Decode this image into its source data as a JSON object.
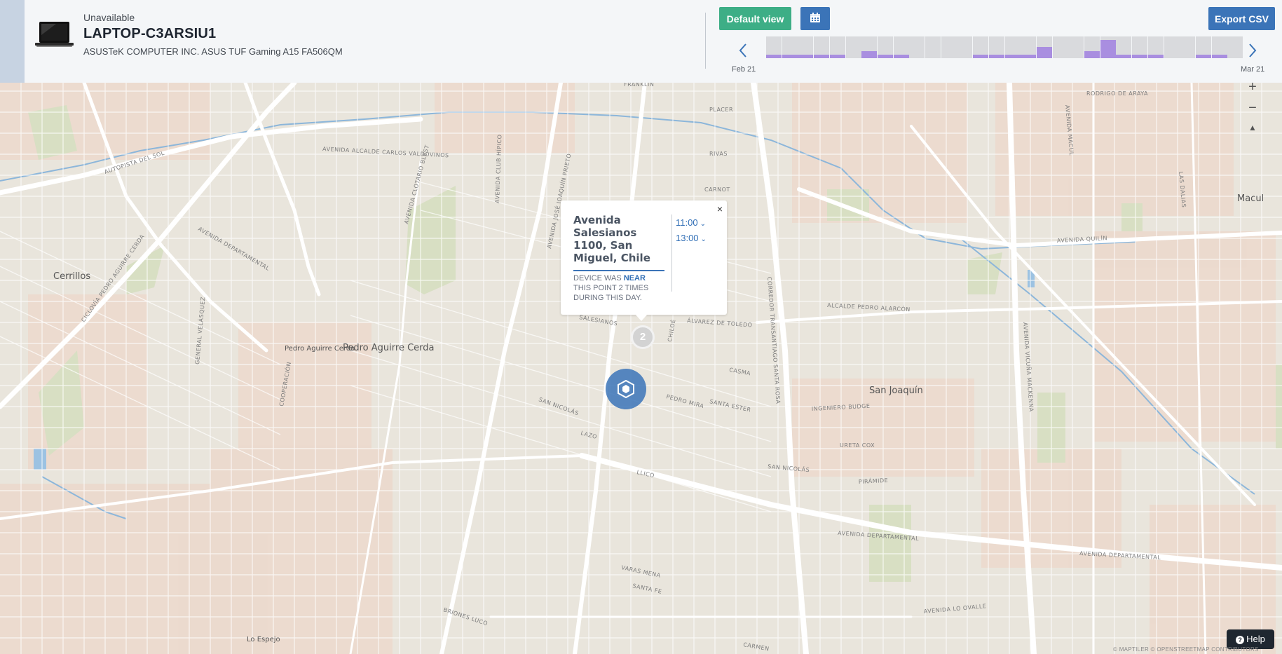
{
  "device": {
    "status": "Unavailable",
    "name": "LAPTOP-C3ARSIU1",
    "model": "ASUSTeK COMPUTER INC. ASUS TUF Gaming A15 FA506QM",
    "icon": "laptop-icon"
  },
  "toolbar": {
    "default_view_label": "Default view",
    "calendar_icon": "calendar-icon",
    "export_label": "Export CSV"
  },
  "timeline": {
    "start_label": "Feb 21",
    "end_label": "Mar 21",
    "activity": [
      0.2,
      0.2,
      0.2,
      0.2,
      0.2,
      0,
      0.4,
      0.2,
      0.2,
      0,
      0,
      0,
      0,
      0.2,
      0.2,
      0.2,
      0.2,
      0.6,
      0,
      0,
      0.4,
      1,
      0.2,
      0.2,
      0.2,
      0,
      0,
      0.2,
      0.2,
      0
    ],
    "active_color": "#a98ee0",
    "inactive_color": "#d9dadd"
  },
  "map": {
    "zoom_in": "+",
    "zoom_out": "−",
    "compass": "▲",
    "labels": {
      "cerrillos": "Cerrillos",
      "pedro_aguirre_cerda": "Pedro Aguirre Cerda",
      "pedro_aguirre_cerda_small": "Pedro Aguirre Cerda",
      "san_joaquin": "San Joaquín",
      "macul": "Macul",
      "lo_espejo": "Lo Espejo"
    },
    "streets": {
      "franklin": "FRANKLIN",
      "placer": "PLACER",
      "rodrigo_de_araya": "RODRIGO DE ARAYA",
      "rivas": "RIVAS",
      "carnot": "CARNOT",
      "alcalde_carlos_valdovinos": "AVENIDA ALCALDE CARLOS VALDOVINOS",
      "autopista_del_sol": "AUTOPISTA DEL SOL",
      "departamental_w": "AVENIDA DEPARTAMENTAL",
      "departamental_e": "AVENIDA DEPARTAMENTAL",
      "departamental_far_e": "AVENIDA DEPARTAMENTAL",
      "quilin": "AVENIDA QUILÍN",
      "pedro_alarcon": "ALCALDE PEDRO ALARCÓN",
      "ingeniero_budge": "INGENIERO BUDGE",
      "san_nicolas_w": "SAN NICOLÁS",
      "san_nicolas_e": "SAN NICOLÁS",
      "pedro_mira": "PEDRO MIRA",
      "santa_ester": "SANTA ESTER",
      "llico": "LLICO",
      "lazo": "LAZO",
      "ureta_cox": "URETA COX",
      "piramide": "PIRÁMIDE",
      "varas_mena": "VARAS MENA",
      "santa_fe": "SANTA FE",
      "lo_ovalle": "AVENIDA LO OVALLE",
      "briones_luco": "BRIONES LUCO",
      "carmen": "CARMEN",
      "santa_rosa": "CORREDOR TRANSANTIAGO SANTA ROSA",
      "vicuna_mackenna": "AVENIDA VICUÑA MACKENNA",
      "jose_joaquin_prieto": "AVENIDA JOSÉ JOAQUÍN PRIETO",
      "club_hipico": "AVENIDA CLUB HÍPICO",
      "clotario_blest": "AVENIDA CLOTARIO BLEST",
      "salesianos": "SALESIANOS",
      "alvarez_de_toledo": "ÁLVAREZ DE TOLEDO",
      "la_marina": "CASMA",
      "general_velasquez": "GENERAL VELÁSQUEZ",
      "lo_valledor": "CICLOVÍA PEDRO AGUIRRE CERDA",
      "cooperacion": "COOPERACIÓN",
      "macul_ave": "AVENIDA MACUL",
      "las_dalias": "LAS DALIAS",
      "cuzco": "CHILOÉ"
    },
    "attribution": "© MAPTILER © OPENSTREETMAP CONTRIBUTORS"
  },
  "popup": {
    "address": "Avenida Salesianos 1100, San Miguel, Chile",
    "note_prefix": "DEVICE WAS",
    "note_near": "NEAR",
    "note_suffix": "THIS POINT 2 TIMES DURING THIS DAY.",
    "times": [
      "11:00",
      "13:00"
    ],
    "close": "×"
  },
  "cluster": {
    "count": "2"
  },
  "help": {
    "label": "Help"
  }
}
